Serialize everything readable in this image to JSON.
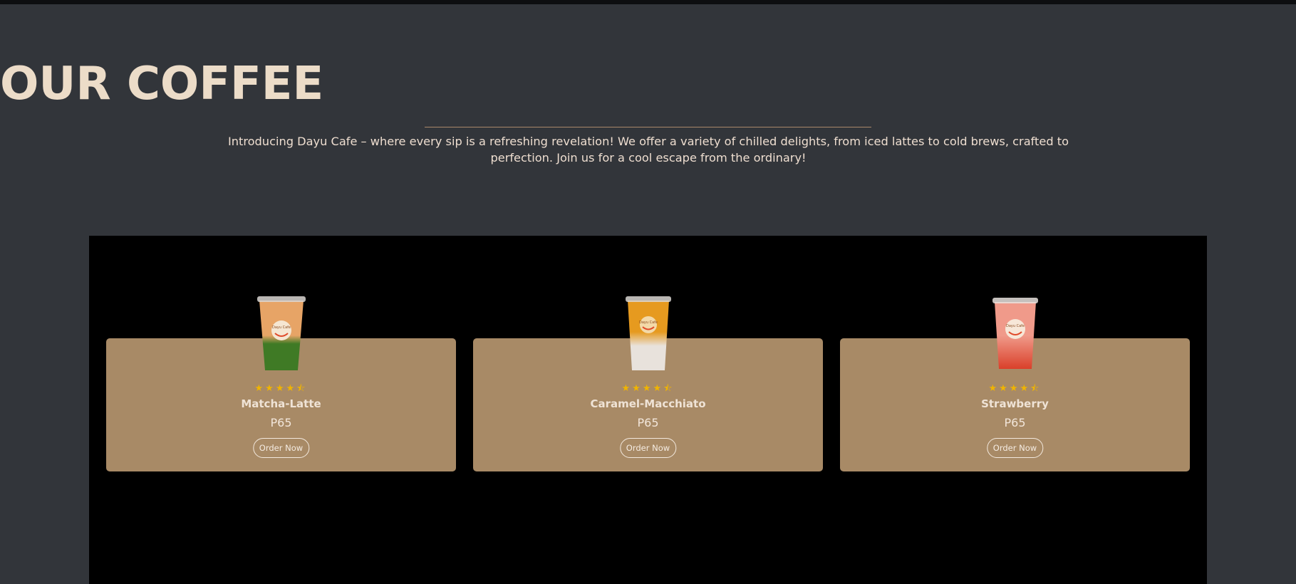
{
  "section": {
    "title": "OUR COFFEE",
    "intro": "Introducing Dayu Cafe – where every sip is a refreshing revelation! We offer a variety of chilled delights, from iced lattes to cold brews, crafted to perfection. Join us for a cool escape from the ordinary!"
  },
  "colors": {
    "background": "#32353a",
    "title": "#ecdcc8",
    "card": "#a88a66",
    "star": "#f0b400",
    "panel": "#000000"
  },
  "products": [
    {
      "name": "Matcha-Latte",
      "price": "P65",
      "rating": 4.5,
      "rating_stars": "★★★★⯪",
      "order_label": "Order Now",
      "cup_top": "#e7a466",
      "cup_bottom": "#3f7a25",
      "cup_logo_text": "Dayu Cafe"
    },
    {
      "name": "Caramel-Macchiato",
      "price": "P65",
      "rating": 4.5,
      "rating_stars": "★★★★⯪",
      "order_label": "Order Now",
      "cup_top": "#e69a1f",
      "cup_bottom": "#e8e2dc",
      "cup_logo_text": "Dayu Cafe"
    },
    {
      "name": "Strawberry",
      "price": "P65",
      "rating": 4.5,
      "rating_stars": "★★★★⯪",
      "order_label": "Order Now",
      "cup_top": "#f09a8a",
      "cup_bottom": "#d9402a",
      "cup_logo_text": "Dayu Cafe"
    }
  ]
}
